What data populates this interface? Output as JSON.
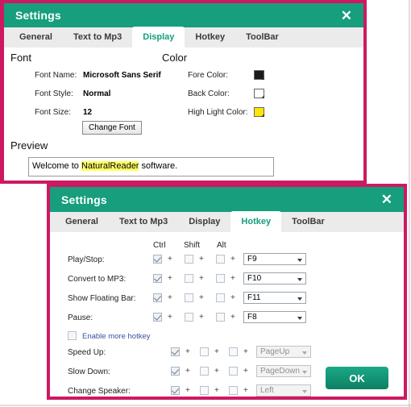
{
  "theme": {
    "header_green": "#169e7d",
    "border_magenta": "#cc1a62",
    "tab_active_text": "#169e7d",
    "link_blue": "#3b4fa0",
    "highlight_yellow": "#ffff66"
  },
  "display_dialog": {
    "title": "Settings",
    "close_icon": "close-icon",
    "close_glyph": "✕",
    "tabs": [
      {
        "label": "General",
        "active": false
      },
      {
        "label": "Text to Mp3",
        "active": false
      },
      {
        "label": "Display",
        "active": true
      },
      {
        "label": "Hotkey",
        "active": false
      },
      {
        "label": "ToolBar",
        "active": false
      }
    ],
    "font_section": {
      "heading": "Font",
      "rows": [
        {
          "label": "Font Name:",
          "value": "Microsoft Sans Serif"
        },
        {
          "label": "Font Style:",
          "value": "Normal"
        },
        {
          "label": "Font Size:",
          "value": "12"
        }
      ],
      "change_font_button": "Change Font"
    },
    "color_section": {
      "heading": "Color",
      "rows": [
        {
          "label": "Fore Color:",
          "color": "#1a1a1a"
        },
        {
          "label": "Back Color:",
          "color": "#ffffff"
        },
        {
          "label": "High Light Color:",
          "color": "#ffe600"
        }
      ]
    },
    "preview_section": {
      "heading": "Preview",
      "text_before": "Welcome to ",
      "text_highlight": "NaturalReader",
      "text_after": " software."
    }
  },
  "hotkey_dialog": {
    "title": "Settings",
    "close_icon": "close-icon",
    "close_glyph": "✕",
    "tabs": [
      {
        "label": "General",
        "active": false
      },
      {
        "label": "Text to Mp3",
        "active": false
      },
      {
        "label": "Display",
        "active": false
      },
      {
        "label": "Hotkey",
        "active": true
      },
      {
        "label": "ToolBar",
        "active": false
      }
    ],
    "columns": {
      "ctrl": "Ctrl",
      "shift": "Shift",
      "alt": "Alt",
      "plus": "+"
    },
    "rows": [
      {
        "label": "Play/Stop:",
        "ctrl": true,
        "shift": false,
        "alt": false,
        "key": "F9",
        "disabled": false
      },
      {
        "label": "Convert to MP3:",
        "ctrl": true,
        "shift": false,
        "alt": false,
        "key": "F10",
        "disabled": false
      },
      {
        "label": "Show Floating Bar:",
        "ctrl": true,
        "shift": false,
        "alt": false,
        "key": "F11",
        "disabled": false
      },
      {
        "label": "Pause:",
        "ctrl": true,
        "shift": false,
        "alt": false,
        "key": "F8",
        "disabled": false
      }
    ],
    "enable_more": {
      "label": "Enable more hotkey",
      "checked": false
    },
    "extra_rows": [
      {
        "label": "Speed Up:",
        "ctrl": true,
        "shift": false,
        "alt": false,
        "key": "PageUp",
        "disabled": true
      },
      {
        "label": "Slow Down:",
        "ctrl": true,
        "shift": false,
        "alt": false,
        "key": "PageDown",
        "disabled": true
      },
      {
        "label": "Change Speaker:",
        "ctrl": true,
        "shift": false,
        "alt": false,
        "key": "Left",
        "disabled": true
      }
    ],
    "ok_button": "OK"
  }
}
